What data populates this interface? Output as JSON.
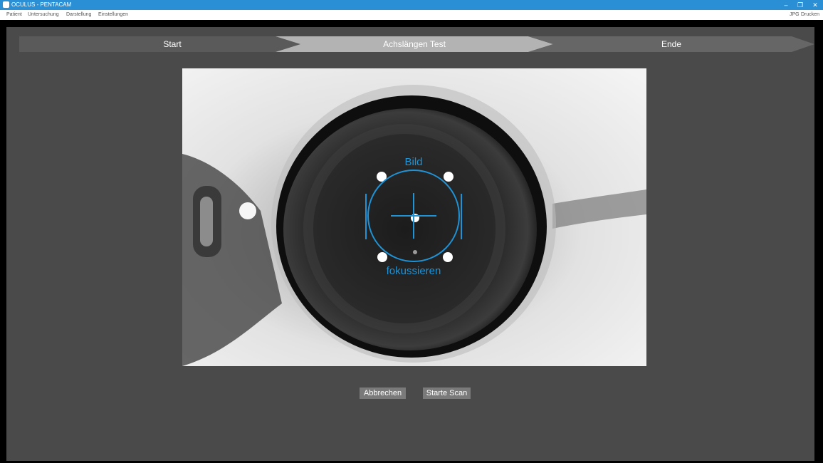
{
  "window": {
    "title": "OCULUS - PENTACAM",
    "icon": "oculus-app-icon",
    "controls": {
      "minimize": "–",
      "restore": "❐",
      "close": "✕"
    }
  },
  "menu": {
    "items": [
      "Patient",
      "Untersuchung",
      "Darstellung",
      "Einstellungen"
    ],
    "right_items": [
      "JPG",
      "Drucken"
    ]
  },
  "steps": [
    {
      "label": "Start",
      "state": "done"
    },
    {
      "label": "Achslängen Test",
      "state": "active"
    },
    {
      "label": "Ende",
      "state": "pending"
    }
  ],
  "camera": {
    "overlay_top": "Bild",
    "overlay_bottom": "fokussieren",
    "overlay_color": "#1f93d6"
  },
  "buttons": {
    "cancel": "Abbrechen",
    "start_scan": "Starte Scan"
  },
  "colors": {
    "titlebar": "#2a8fd4",
    "panel": "#4a4a4a",
    "step_done": "#5a5a5a",
    "step_active": "#b3b3b3",
    "step_pending": "#666666",
    "button": "#7a7a7a"
  }
}
